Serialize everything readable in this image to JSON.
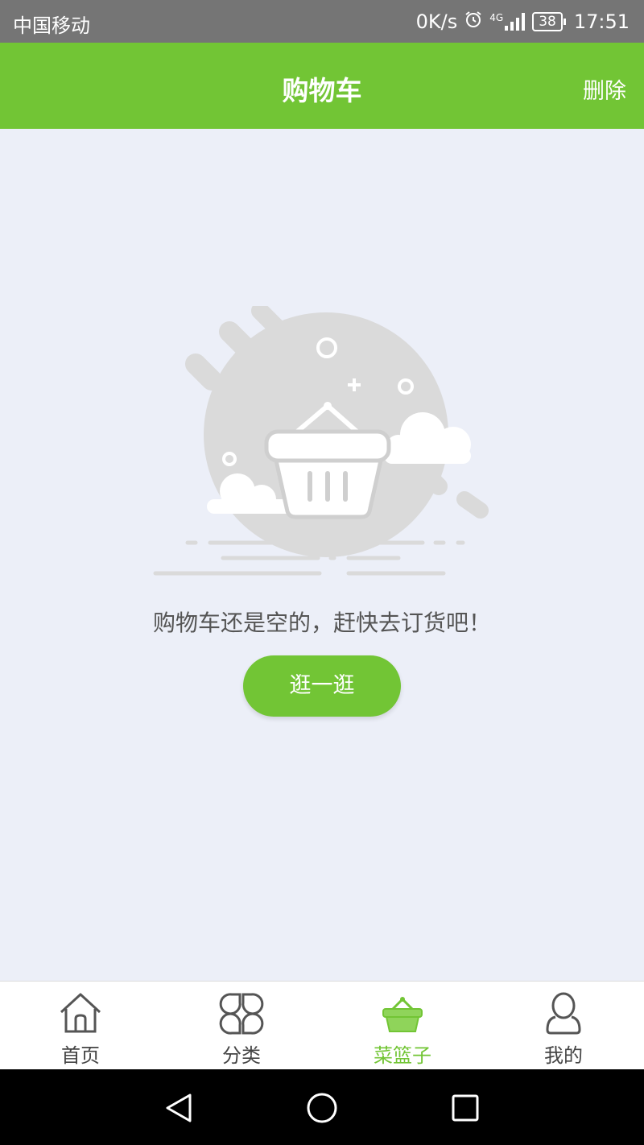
{
  "status_bar": {
    "carrier": "中国移动",
    "speed": "0K/s",
    "network": "4G",
    "battery": "38",
    "time": "17:51"
  },
  "header": {
    "title": "购物车",
    "action_label": "删除"
  },
  "empty_state": {
    "message": "购物车还是空的，赶快去订货吧！",
    "button_label": "逛一逛",
    "illustration": "empty-basket-illustration"
  },
  "tabs": [
    {
      "label": "首页",
      "icon": "home-icon",
      "active": false
    },
    {
      "label": "分类",
      "icon": "category-icon",
      "active": false
    },
    {
      "label": "菜篮子",
      "icon": "basket-icon",
      "active": true
    },
    {
      "label": "我的",
      "icon": "user-icon",
      "active": false
    }
  ],
  "colors": {
    "brand": "#72c535",
    "background": "#eceff8",
    "status_bar": "#757575"
  },
  "nav_bar": {
    "back_icon": "back-triangle-icon",
    "home_icon": "home-circle-icon",
    "recents_icon": "recents-square-icon"
  }
}
